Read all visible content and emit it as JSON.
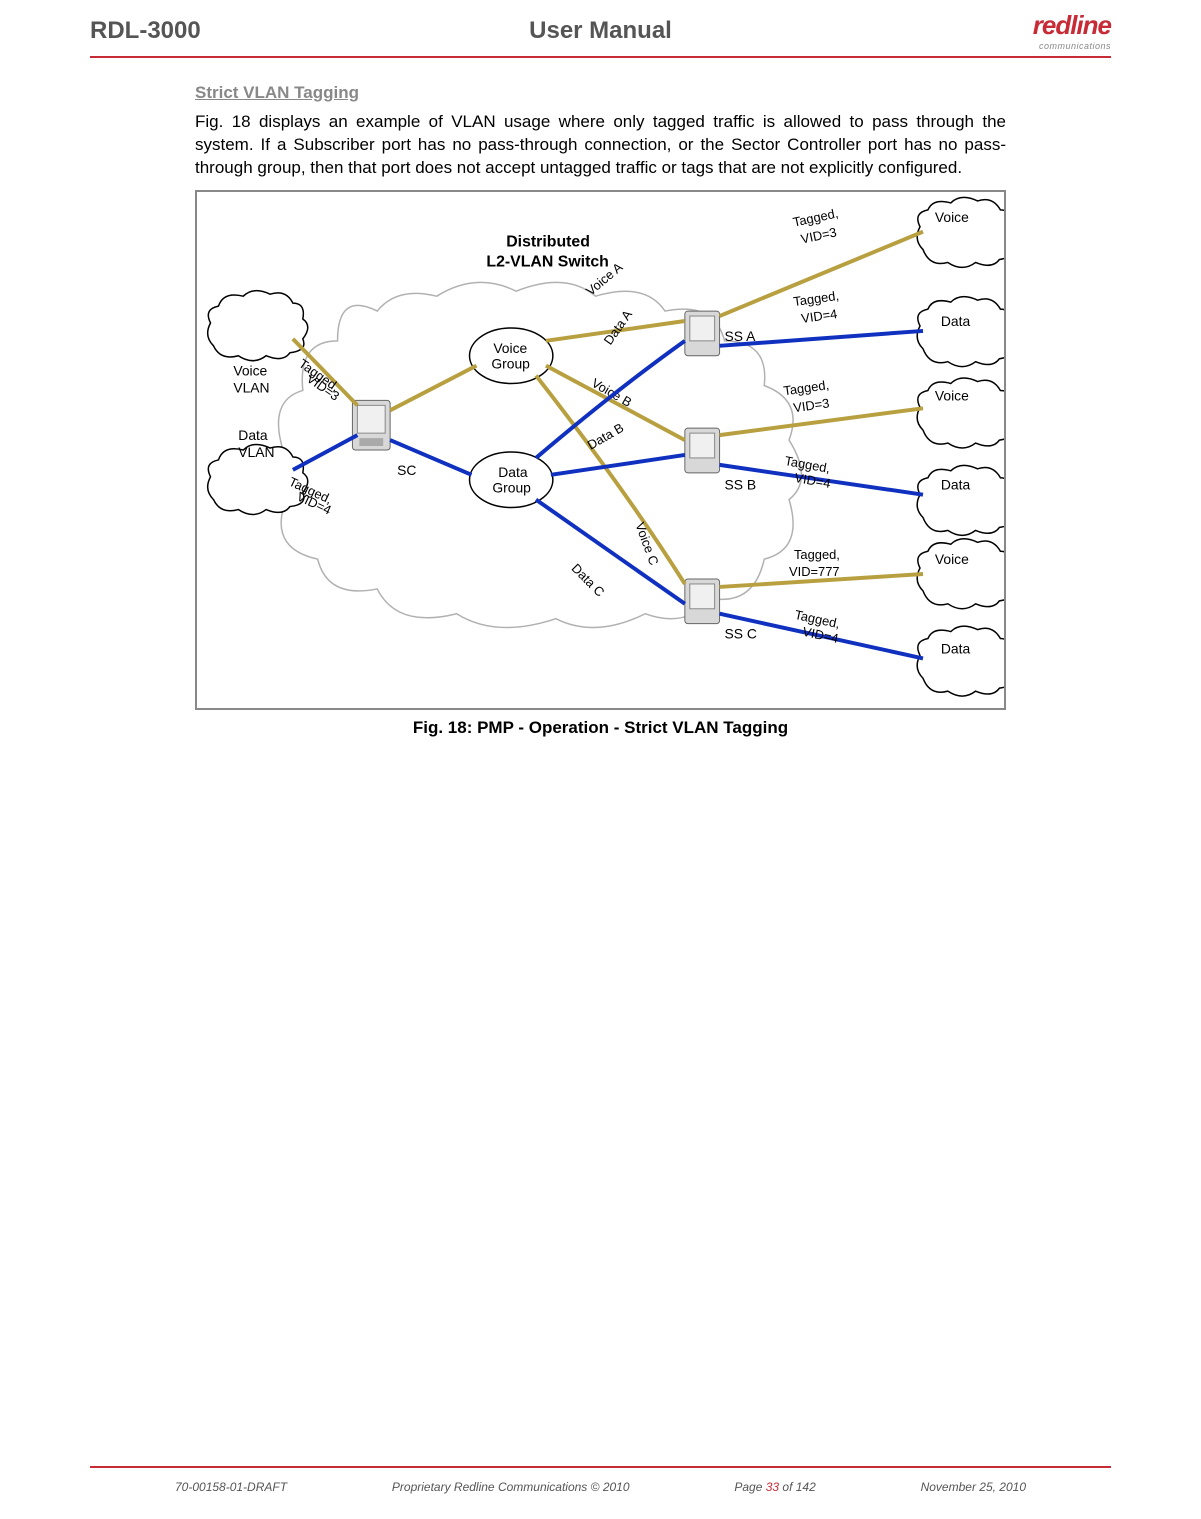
{
  "header": {
    "docId": "RDL-3000",
    "title": "User Manual",
    "logo": "redline",
    "logoSub": "communications"
  },
  "page": {
    "sectionTitle": "Strict VLAN Tagging",
    "bodyText": "Fig. 18 displays an example of VLAN usage where only tagged traffic is allowed to pass through the system. If a Subscriber port has no pass-through connection, or the Sector Controller port has no pass-through group, then that port does not accept untagged traffic or tags that are not explicitly configured.",
    "figureCaption": "Fig. 18: PMP - Operation - Strict VLAN Tagging"
  },
  "diagram": {
    "title1": "Distributed",
    "title2": "L2-VLAN Switch",
    "labels": {
      "voiceVlan": "Voice",
      "voiceVlan2": "VLAN",
      "dataVlan": "Data",
      "dataVlan2": "VLAN",
      "sc": "SC",
      "voiceGroup1": "Voice",
      "voiceGroup2": "Group",
      "dataGroup1": "Data",
      "dataGroup2": "Group",
      "ssA": "SS A",
      "ssB": "SS B",
      "ssC": "SS C",
      "voice": "Voice",
      "data": "Data",
      "voiceA": "Voice A",
      "dataA": "Data A",
      "voiceB": "Voice B",
      "dataB": "Data B",
      "voiceC": "Voice C",
      "dataC": "Data C",
      "tagged": "Tagged,",
      "vid3": "VID=3",
      "vid4": "VID=4",
      "vid777": "VID=777"
    }
  },
  "footer": {
    "docNum": "70-00158-01-DRAFT",
    "copyright": "Proprietary Redline Communications © 2010",
    "pagePrefix": "Page ",
    "pageNum": "33",
    "pageSuffix": " of 142",
    "date": "November 25, 2010"
  }
}
